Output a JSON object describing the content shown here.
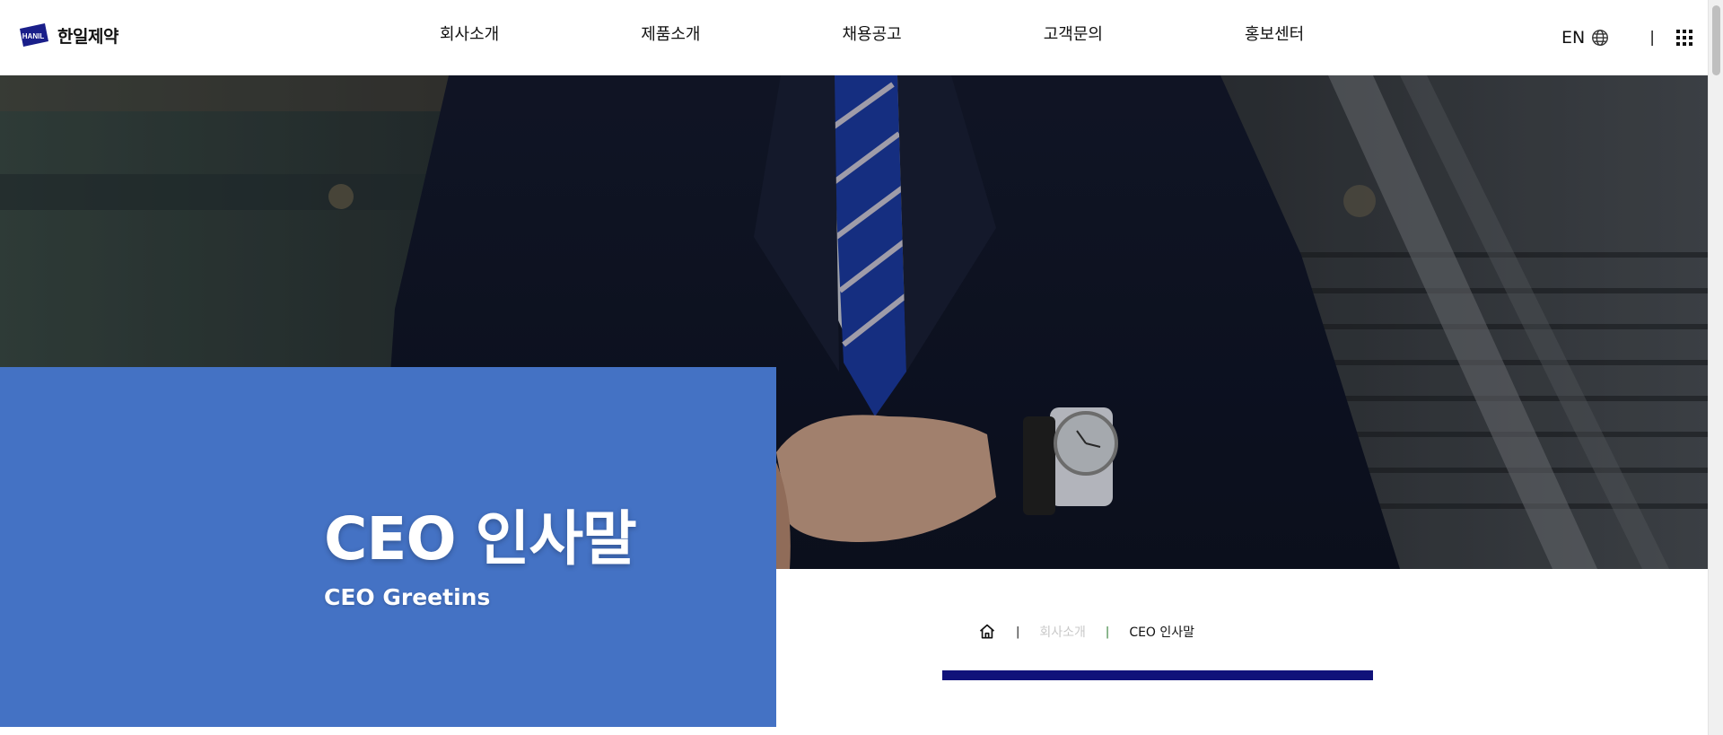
{
  "header": {
    "logo_mark_text": "HANIL",
    "logo_text": "한일제약",
    "nav": [
      {
        "label": "회사소개"
      },
      {
        "label": "제품소개"
      },
      {
        "label": "채용공고"
      },
      {
        "label": "고객문의"
      },
      {
        "label": "홍보센터"
      }
    ],
    "lang_label": "EN",
    "separator": "|"
  },
  "hero": {
    "title": "CEO 인사말",
    "subtitle": "CEO Greetins"
  },
  "breadcrumb": {
    "separator": "|",
    "parent": "회사소개",
    "current": "CEO 인사말"
  },
  "colors": {
    "accent_blue": "#4472c4",
    "navy_bar": "#10127a",
    "logo_navy": "#1a1f8a"
  },
  "icons": {
    "home": "home-icon",
    "globe": "globe-icon",
    "menu": "grid-menu-icon"
  }
}
